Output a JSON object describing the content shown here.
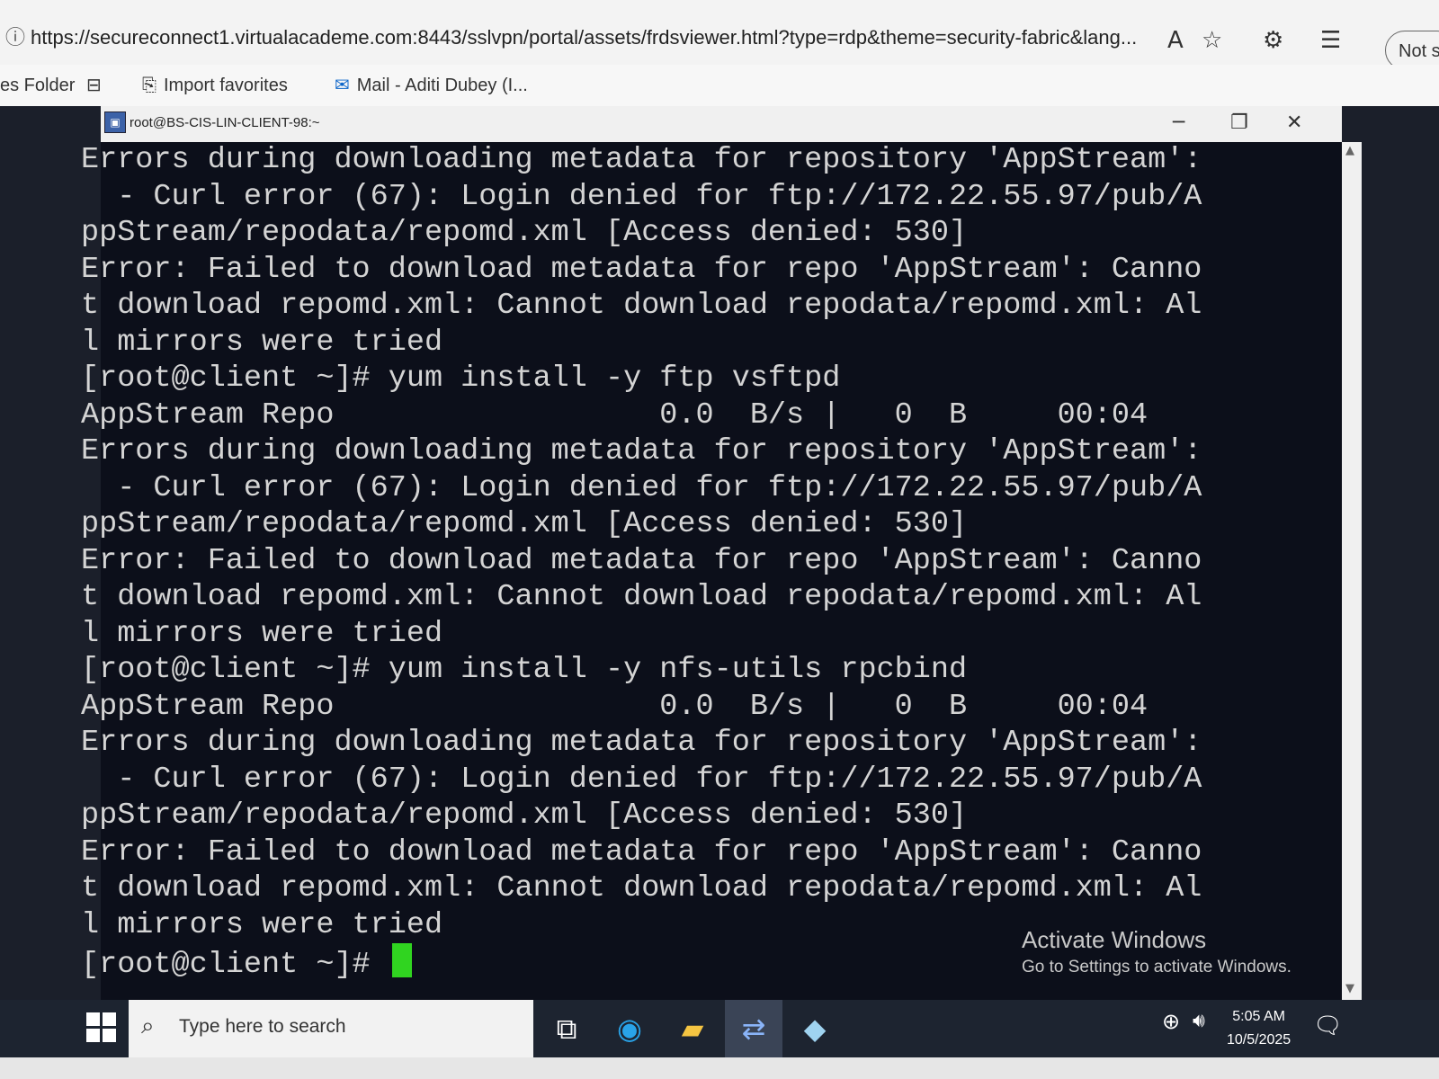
{
  "browser": {
    "url": "https://secureconnect1.virtualacademe.com:8443/sslvpn/portal/assets/frdsviewer.html?type=rdp&theme=security-fabric&lang...",
    "not_secure_label": "Not s"
  },
  "favorites": {
    "items": [
      {
        "label": "es Folder"
      },
      {
        "label": "Import favorites"
      },
      {
        "label": "Mail - Aditi Dubey (I..."
      }
    ]
  },
  "putty": {
    "title": "root@BS-CIS-LIN-CLIENT-98:~"
  },
  "terminal": {
    "lines": [
      "Errors during downloading metadata for repository 'AppStream':",
      "  - Curl error (67): Login denied for ftp://172.22.55.97/pub/A",
      "ppStream/repodata/repomd.xml [Access denied: 530]",
      "Error: Failed to download metadata for repo 'AppStream': Canno",
      "t download repomd.xml: Cannot download repodata/repomd.xml: Al",
      "l mirrors were tried",
      "[root@client ~]# yum install -y ftp vsftpd",
      "AppStream Repo                  0.0  B/s |   0  B     00:04",
      "Errors during downloading metadata for repository 'AppStream':",
      "  - Curl error (67): Login denied for ftp://172.22.55.97/pub/A",
      "ppStream/repodata/repomd.xml [Access denied: 530]",
      "Error: Failed to download metadata for repo 'AppStream': Canno",
      "t download repomd.xml: Cannot download repodata/repomd.xml: Al",
      "l mirrors were tried",
      "[root@client ~]# yum install -y nfs-utils rpcbind",
      "AppStream Repo                  0.0  B/s |   0  B     00:04",
      "Errors during downloading metadata for repository 'AppStream':",
      "  - Curl error (67): Login denied for ftp://172.22.55.97/pub/A",
      "ppStream/repodata/repomd.xml [Access denied: 530]",
      "Error: Failed to download metadata for repo 'AppStream': Canno",
      "t download repomd.xml: Cannot download repodata/repomd.xml: Al",
      "l mirrors were tried"
    ],
    "prompt": "[root@client ~]# "
  },
  "watermark": {
    "title": "Activate Windows",
    "subtitle": "Go to Settings to activate Windows."
  },
  "taskbar": {
    "search_placeholder": "Type here to search",
    "time": "5:05 AM",
    "date": "10/5/2025"
  }
}
